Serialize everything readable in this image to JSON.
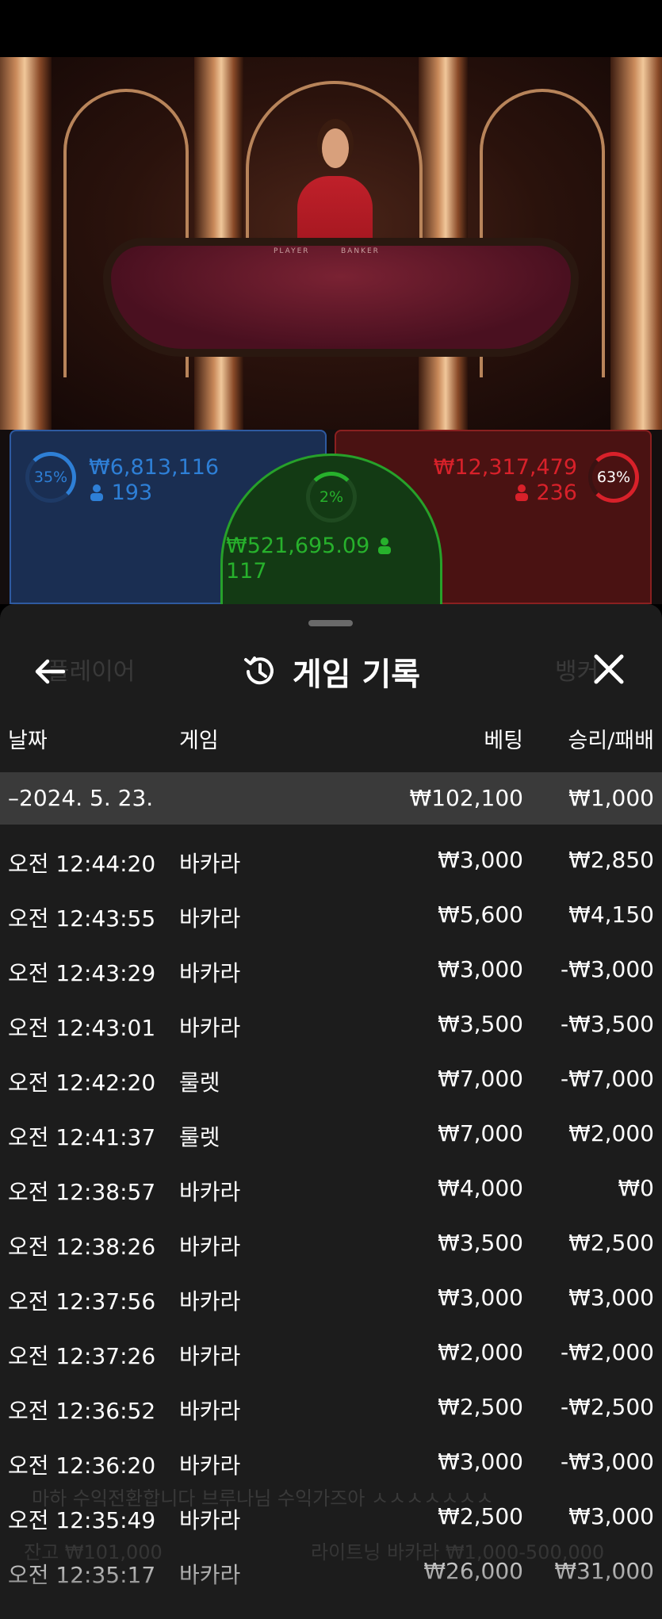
{
  "betting": {
    "player": {
      "percent": "35%",
      "amount": "₩6,813,116",
      "players": "193",
      "color": "#2e7fd6"
    },
    "tie": {
      "percent": "2%",
      "amount": "₩521,695.09",
      "players": "117",
      "color": "#27b12c"
    },
    "banker": {
      "percent": "63%",
      "amount": "₩12,317,479",
      "players": "236",
      "color": "#d8212a"
    }
  },
  "video": {
    "table_left_label": "PLAYER",
    "table_right_label": "BANKER"
  },
  "background_ghost": {
    "player_label": "플레이어",
    "banker_label": "뱅커",
    "chat": "마하 수익전환합니다 브루나님 수익가즈아 ㅅㅅㅅㅅㅅㅅㅅ",
    "balance": "잔고 ₩101,000",
    "table_name": "라이트닝 바카라 ₩1,000-500,000"
  },
  "history": {
    "title": "게임 기록",
    "columns": {
      "date": "날짜",
      "game": "게임",
      "bet": "베팅",
      "win_loss": "승리/패배"
    },
    "summary": {
      "date": "–2024. 5. 23.",
      "bet": "₩102,100",
      "result": "₩1,000"
    },
    "rows": [
      {
        "time": "오전 12:44:20",
        "game": "바카라",
        "bet": "₩3,000",
        "result": "₩2,850"
      },
      {
        "time": "오전 12:43:55",
        "game": "바카라",
        "bet": "₩5,600",
        "result": "₩4,150"
      },
      {
        "time": "오전 12:43:29",
        "game": "바카라",
        "bet": "₩3,000",
        "result": "-₩3,000"
      },
      {
        "time": "오전 12:43:01",
        "game": "바카라",
        "bet": "₩3,500",
        "result": "-₩3,500"
      },
      {
        "time": "오전 12:42:20",
        "game": "룰렛",
        "bet": "₩7,000",
        "result": "-₩7,000"
      },
      {
        "time": "오전 12:41:37",
        "game": "룰렛",
        "bet": "₩7,000",
        "result": "₩2,000"
      },
      {
        "time": "오전 12:38:57",
        "game": "바카라",
        "bet": "₩4,000",
        "result": "₩0"
      },
      {
        "time": "오전 12:38:26",
        "game": "바카라",
        "bet": "₩3,500",
        "result": "₩2,500"
      },
      {
        "time": "오전 12:37:56",
        "game": "바카라",
        "bet": "₩3,000",
        "result": "₩3,000"
      },
      {
        "time": "오전 12:37:26",
        "game": "바카라",
        "bet": "₩2,000",
        "result": "-₩2,000"
      },
      {
        "time": "오전 12:36:52",
        "game": "바카라",
        "bet": "₩2,500",
        "result": "-₩2,500"
      },
      {
        "time": "오전 12:36:20",
        "game": "바카라",
        "bet": "₩3,000",
        "result": "-₩3,000"
      },
      {
        "time": "오전 12:35:49",
        "game": "바카라",
        "bet": "₩2,500",
        "result": "₩3,000"
      },
      {
        "time": "오전 12:35:17",
        "game": "바카라",
        "bet": "₩26,000",
        "result": "₩31,000"
      }
    ]
  },
  "icons": {
    "back": "arrow-left-icon",
    "history": "history-clock-icon",
    "close": "close-x-icon",
    "person": "person-icon"
  }
}
